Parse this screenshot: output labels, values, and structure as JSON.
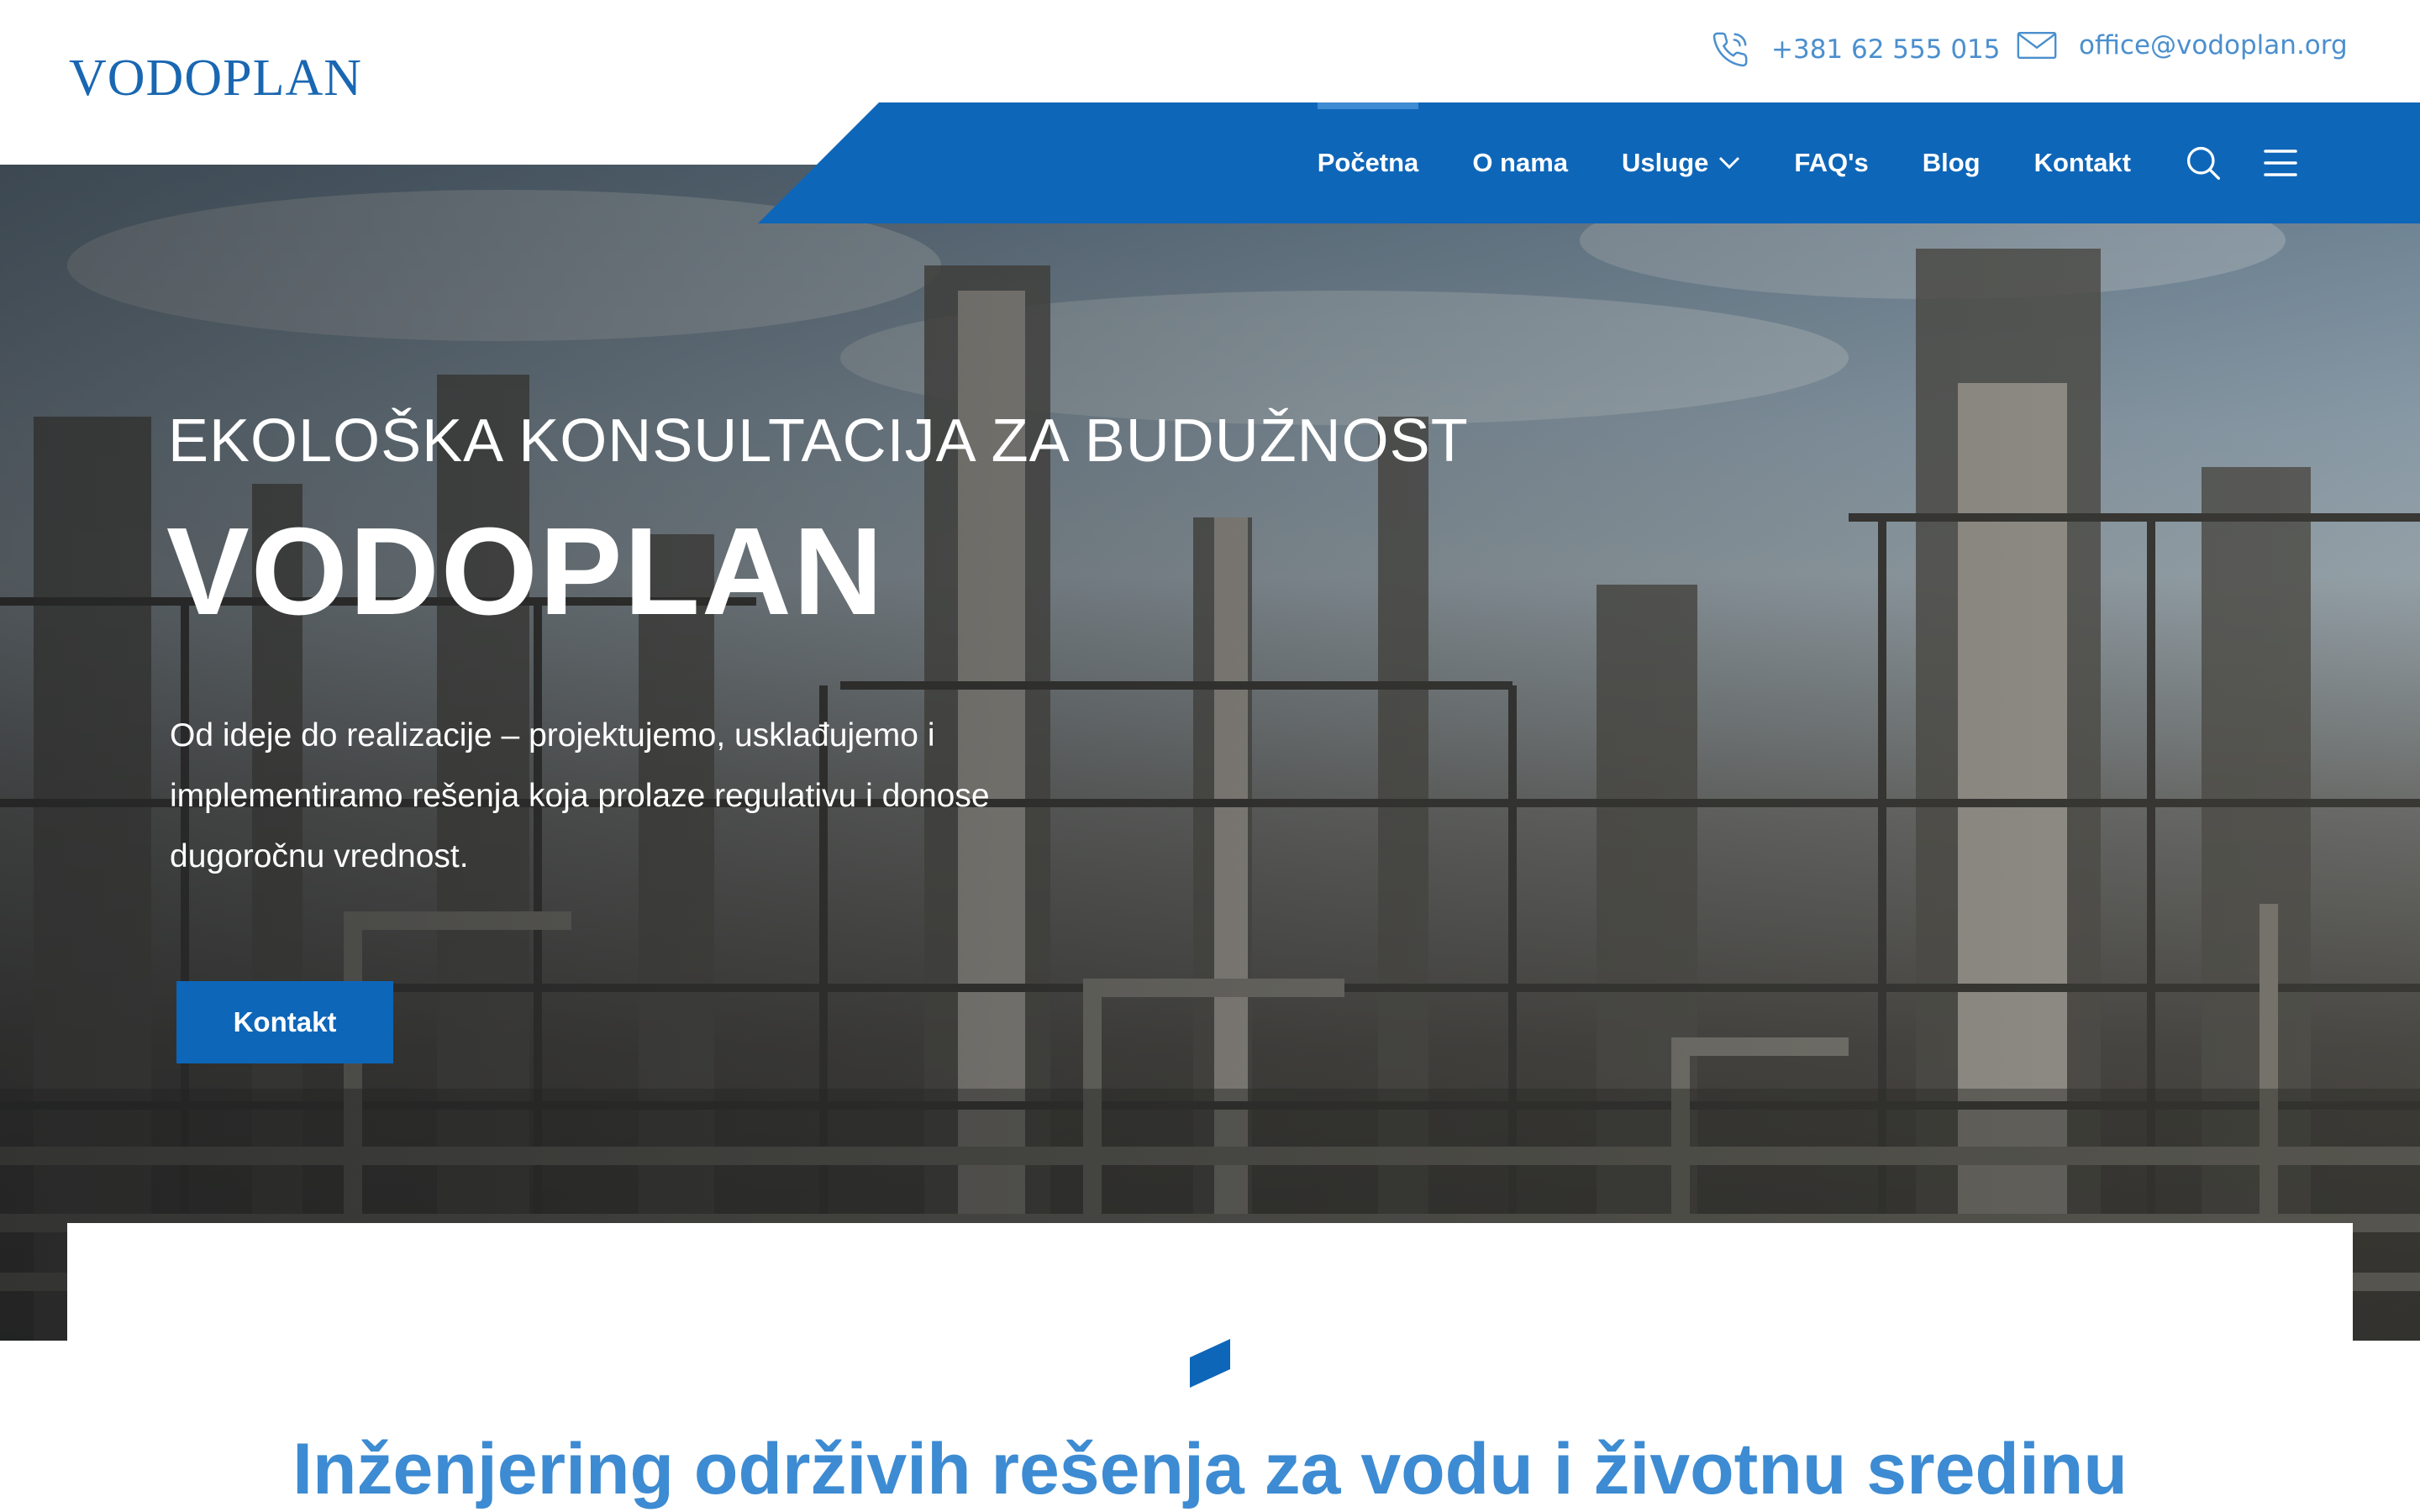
{
  "brand": {
    "logo_text": "VODOPLAN",
    "primary_color": "#0e66b8",
    "accent_color": "#3d8bd2"
  },
  "contact": {
    "phone": "+381 62 555 015",
    "email": "office@vodoplan.org",
    "phone_icon": "phone-icon",
    "email_icon": "mail-icon"
  },
  "nav": {
    "items": [
      {
        "label": "Početna",
        "active": true
      },
      {
        "label": "O nama"
      },
      {
        "label": "Usluge",
        "has_dropdown": true
      },
      {
        "label": "FAQ's"
      },
      {
        "label": "Blog"
      },
      {
        "label": "Kontakt"
      }
    ],
    "search_icon": "search-icon",
    "menu_icon": "hamburger-menu-icon"
  },
  "hero": {
    "eyebrow": "EKOLOŠKA KONSULTACIJA ZA BUDUŽNOST",
    "title": "VODOPLAN",
    "description": "Od ideje do realizacije – projektujemo, usklađujemo i implementiramo rešenja koja prolaze regulativu i donose dugoročnu vrednost.",
    "cta_label": "Kontakt"
  },
  "section": {
    "title": "Inženjering održivih rešenja za vodu i životnu sredinu"
  }
}
